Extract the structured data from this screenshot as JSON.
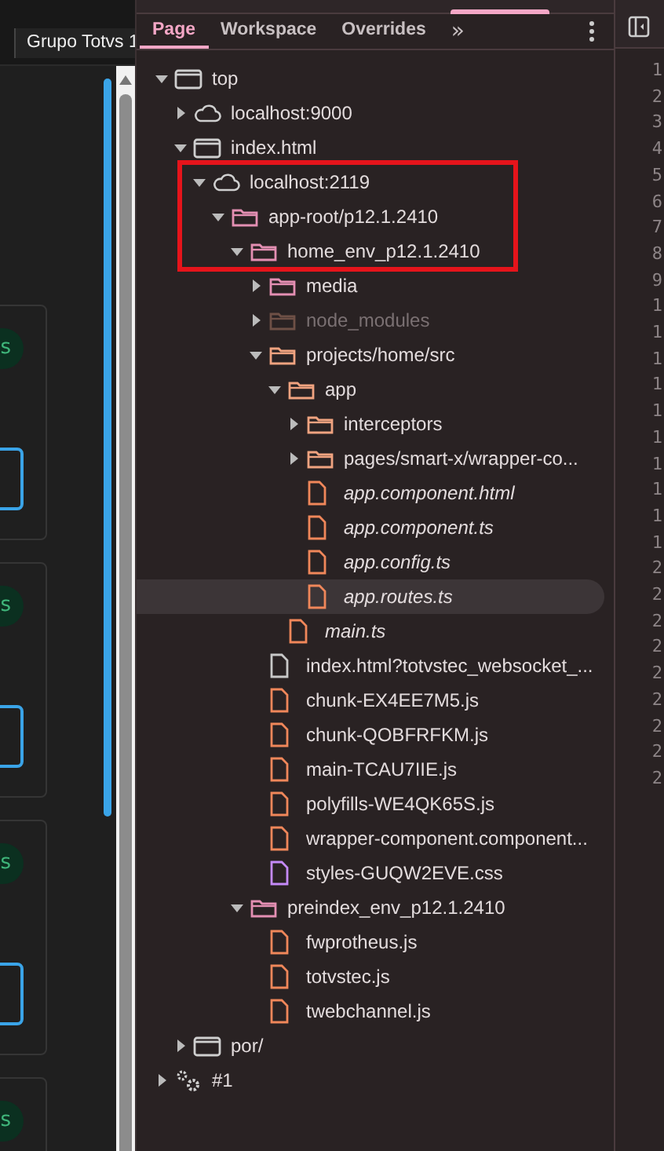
{
  "browser_tab": {
    "title": "Grupo Totvs 1"
  },
  "page_cards": [
    {
      "badge": "s"
    },
    {
      "badge": "s"
    },
    {
      "badge": "s"
    }
  ],
  "partial_card": {
    "badge": "s"
  },
  "tabs": [
    {
      "label": "Page",
      "selected": true
    },
    {
      "label": "Workspace",
      "selected": false
    },
    {
      "label": "Overrides",
      "selected": false
    }
  ],
  "more_tabs": "»",
  "tree": [
    {
      "label": "top",
      "kind": "frame",
      "expanded": true,
      "selected": false,
      "children": [
        {
          "label": "localhost:9000",
          "kind": "cloud",
          "expanded": false,
          "selected": false
        },
        {
          "label": "index.html",
          "kind": "frame",
          "expanded": true,
          "selected": false,
          "children": [
            {
              "label": "localhost:2119",
              "kind": "cloud",
              "expanded": true,
              "selected": false,
              "highlighted": true,
              "children": [
                {
                  "label": "app-root/p12.1.2410",
                  "kind": "folder",
                  "color": "#e48fb3",
                  "expanded": true,
                  "selected": false,
                  "highlighted": true,
                  "children": [
                    {
                      "label": "home_env_p12.1.2410",
                      "kind": "folder",
                      "color": "#e48fb3",
                      "expanded": true,
                      "selected": false,
                      "highlighted": true,
                      "children": [
                        {
                          "label": "media",
                          "kind": "folder",
                          "color": "#e48fb3",
                          "expanded": false,
                          "selected": false
                        },
                        {
                          "label": "node_modules",
                          "kind": "folder",
                          "color": "#6e5046",
                          "expanded": false,
                          "selected": false,
                          "dimmed": true
                        },
                        {
                          "label": "projects/home/src",
                          "kind": "folder",
                          "color": "#f0a380",
                          "expanded": true,
                          "selected": false,
                          "children": [
                            {
                              "label": "app",
                              "kind": "folder",
                              "color": "#f0a380",
                              "expanded": true,
                              "selected": false,
                              "children": [
                                {
                                  "label": "interceptors",
                                  "kind": "folder",
                                  "color": "#f0a380",
                                  "expanded": false,
                                  "selected": false
                                },
                                {
                                  "label": "pages/smart-x/wrapper-co...",
                                  "kind": "folder",
                                  "color": "#f0a380",
                                  "expanded": false,
                                  "selected": false
                                },
                                {
                                  "label": "app.component.html",
                                  "kind": "file",
                                  "color": "#f0875a",
                                  "selected": false,
                                  "source_mapped": true
                                },
                                {
                                  "label": "app.component.ts",
                                  "kind": "file",
                                  "color": "#f0875a",
                                  "selected": false,
                                  "source_mapped": true
                                },
                                {
                                  "label": "app.config.ts",
                                  "kind": "file",
                                  "color": "#f0875a",
                                  "selected": false,
                                  "source_mapped": true
                                },
                                {
                                  "label": "app.routes.ts",
                                  "kind": "file",
                                  "color": "#f0875a",
                                  "selected": true,
                                  "source_mapped": true
                                }
                              ]
                            },
                            {
                              "label": "main.ts",
                              "kind": "file",
                              "color": "#f0875a",
                              "selected": false,
                              "source_mapped": true
                            }
                          ]
                        },
                        {
                          "label": "index.html?totvstec_websocket_...",
                          "kind": "file",
                          "color": "#c8c8c8",
                          "selected": false
                        },
                        {
                          "label": "chunk-EX4EE7M5.js",
                          "kind": "file",
                          "color": "#f0875a",
                          "selected": false
                        },
                        {
                          "label": "chunk-QOBFRFKM.js",
                          "kind": "file",
                          "color": "#f0875a",
                          "selected": false
                        },
                        {
                          "label": "main-TCAU7IIE.js",
                          "kind": "file",
                          "color": "#f0875a",
                          "selected": false
                        },
                        {
                          "label": "polyfills-WE4QK65S.js",
                          "kind": "file",
                          "color": "#f0875a",
                          "selected": false
                        },
                        {
                          "label": "wrapper-component.component...",
                          "kind": "file",
                          "color": "#f0875a",
                          "selected": false
                        },
                        {
                          "label": "styles-GUQW2EVE.css",
                          "kind": "file",
                          "color": "#c58af9",
                          "selected": false
                        }
                      ]
                    },
                    {
                      "label": "preindex_env_p12.1.2410",
                      "kind": "folder",
                      "color": "#e48fb3",
                      "expanded": true,
                      "selected": false,
                      "children": [
                        {
                          "label": "fwprotheus.js",
                          "kind": "file",
                          "color": "#f0875a",
                          "selected": false
                        },
                        {
                          "label": "totvstec.js",
                          "kind": "file",
                          "color": "#f0875a",
                          "selected": false
                        },
                        {
                          "label": "twebchannel.js",
                          "kind": "file",
                          "color": "#f0875a",
                          "selected": false
                        }
                      ]
                    }
                  ]
                }
              ]
            }
          ]
        },
        {
          "label": "por/",
          "kind": "frame",
          "expanded": false,
          "selected": false
        }
      ]
    },
    {
      "label": "#1",
      "kind": "gears",
      "expanded": false,
      "selected": false
    }
  ],
  "line_numbers": [
    "1",
    "2",
    "3",
    "4",
    "5",
    "6",
    "7",
    "8",
    "9",
    "1",
    "1",
    "1",
    "1",
    "1",
    "1",
    "1",
    "1",
    "1",
    "1",
    "2",
    "2",
    "2",
    "2",
    "2",
    "2",
    "2",
    "2",
    "2"
  ]
}
